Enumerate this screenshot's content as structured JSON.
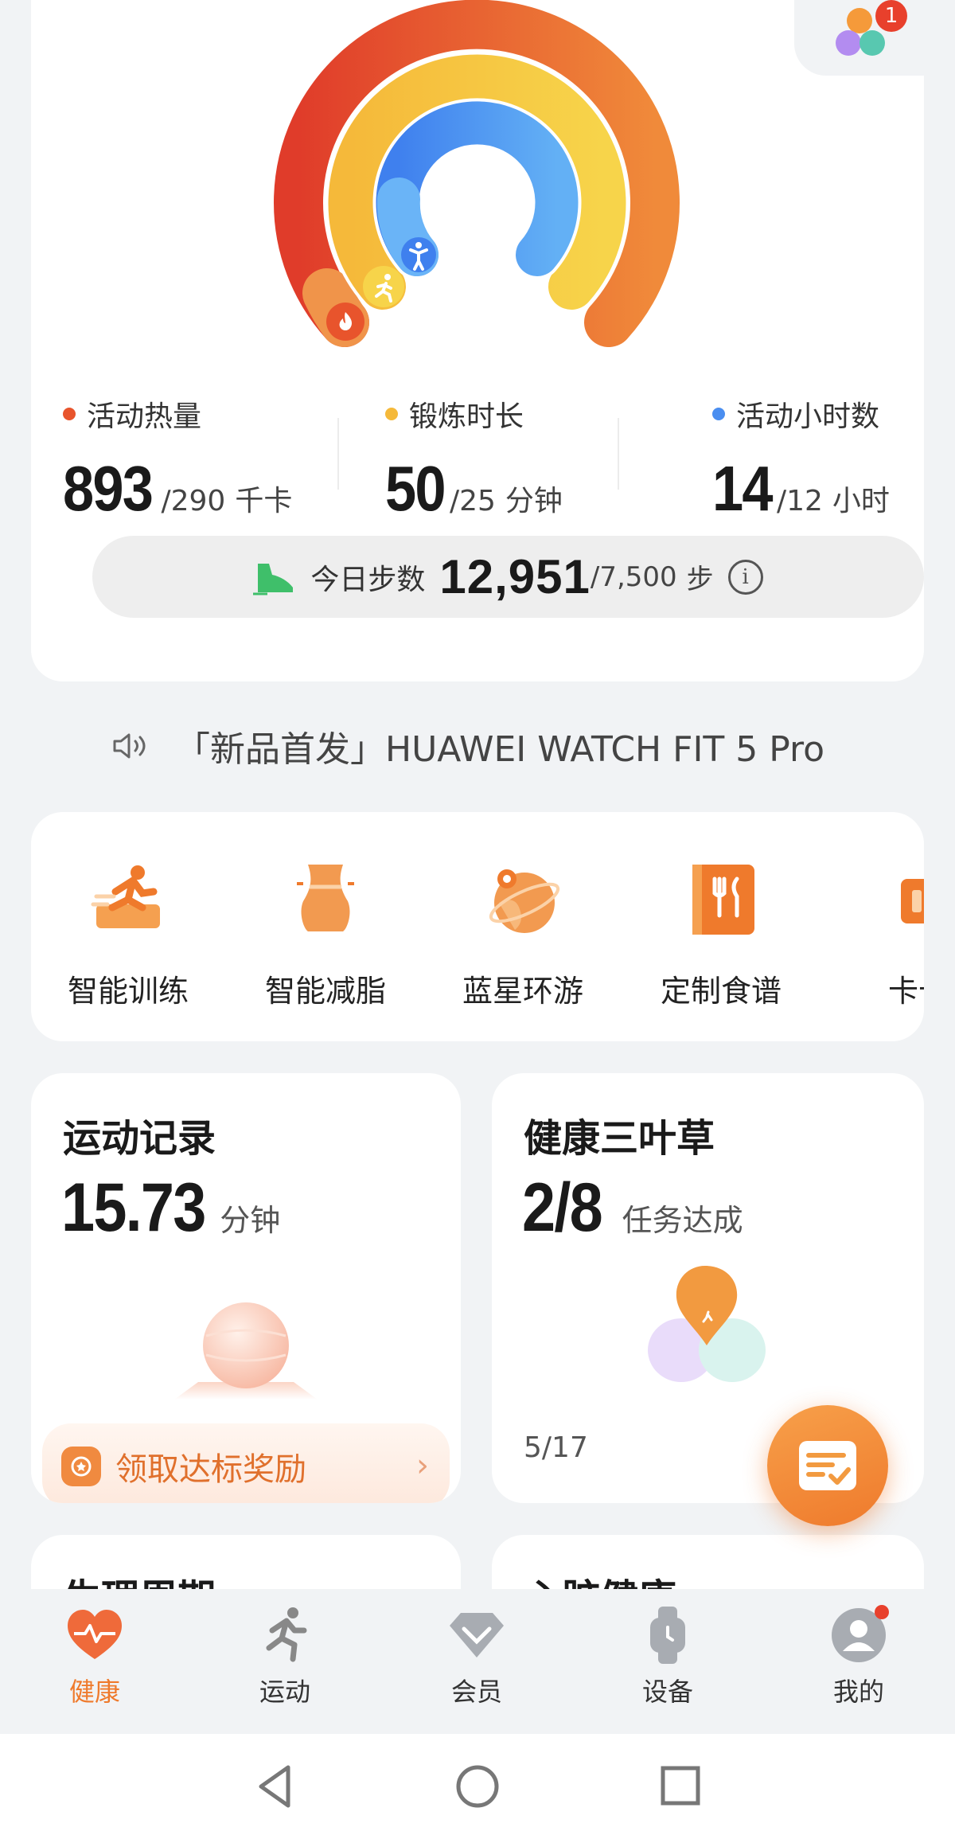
{
  "corner_apps": {
    "badge": "1"
  },
  "rings": {
    "metrics": [
      {
        "label": "活动热量",
        "value": "893",
        "goal": "/290",
        "unit": "千卡",
        "color": "#e8542c"
      },
      {
        "label": "锻炼时长",
        "value": "50",
        "goal": "/25",
        "unit": "分钟",
        "color": "#f5b93a"
      },
      {
        "label": "活动小时数",
        "value": "14",
        "goal": "/12",
        "unit": "小时",
        "color": "#4a8ef0"
      }
    ],
    "steps": {
      "label": "今日步数",
      "value": "12,951",
      "goal": "/7,500",
      "unit": "步"
    }
  },
  "announcement": {
    "text": "「新品首发」HUAWEI WATCH FIT 5 Pro"
  },
  "shortcuts": [
    {
      "label": "智能训练",
      "icon": "running-training-icon"
    },
    {
      "label": "智能减脂",
      "icon": "waist-fat-loss-icon"
    },
    {
      "label": "蓝星环游",
      "icon": "globe-travel-icon"
    },
    {
      "label": "定制食谱",
      "icon": "recipe-book-icon"
    },
    {
      "label": "卡卡",
      "icon": "card-icon"
    }
  ],
  "exercise_record": {
    "title": "运动记录",
    "value": "15.73",
    "unit": "分钟",
    "reward_label": "领取达标奖励"
  },
  "clover": {
    "title": "健康三叶草",
    "value": "2/8",
    "unit": "任务达成",
    "date": "5/17"
  },
  "next_cards": {
    "left_title": "生理周期",
    "right_title": "心脏健康"
  },
  "bottom_nav": [
    {
      "label": "健康",
      "icon": "heart-pulse-icon",
      "active": true
    },
    {
      "label": "运动",
      "icon": "runner-icon",
      "active": false
    },
    {
      "label": "会员",
      "icon": "diamond-icon",
      "active": false
    },
    {
      "label": "设备",
      "icon": "watch-icon",
      "active": false
    },
    {
      "label": "我的",
      "icon": "profile-icon",
      "active": false
    }
  ],
  "colors": {
    "accent": "#ef7a2c",
    "red": "#e8542c",
    "yellow": "#f5b93a",
    "blue": "#4a8ef0"
  }
}
